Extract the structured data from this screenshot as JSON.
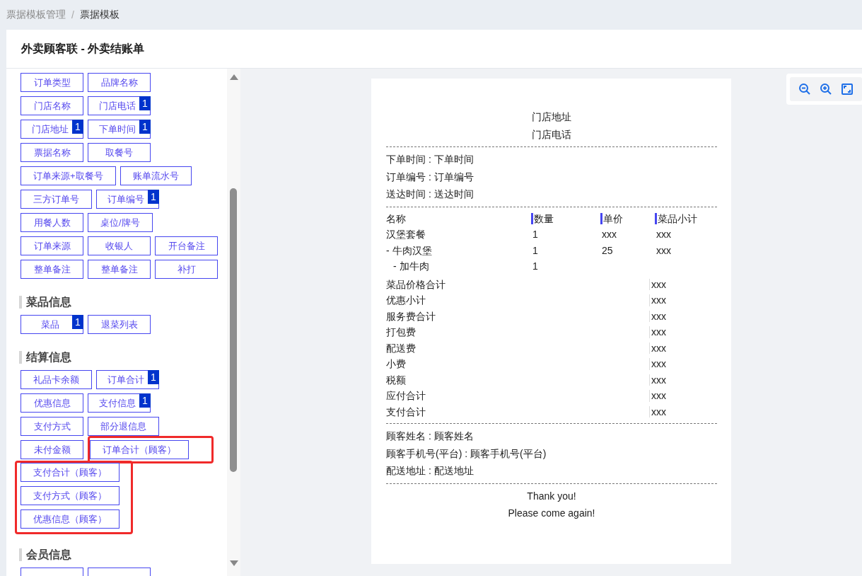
{
  "breadcrumb": {
    "separator": "/",
    "items": [
      {
        "label": "票据模板管理",
        "current": false
      },
      {
        "label": "票据模板",
        "current": true
      }
    ]
  },
  "title": "外卖顾客联 - 外卖结账单",
  "field_sections": [
    {
      "rows": [
        [
          {
            "kind": "chip",
            "label": "订单类型"
          },
          {
            "kind": "chip",
            "label": "品牌名称"
          }
        ],
        [
          {
            "kind": "chip",
            "label": "门店名称"
          },
          {
            "kind": "chip",
            "label": "门店电话",
            "badge": "1"
          }
        ],
        [
          {
            "kind": "chip",
            "label": "门店地址",
            "badge": "1"
          },
          {
            "kind": "chip",
            "label": "下单时间",
            "badge": "1"
          }
        ],
        [
          {
            "kind": "chip",
            "label": "票据名称"
          },
          {
            "kind": "chip",
            "label": "取餐号"
          }
        ],
        [
          {
            "kind": "chip",
            "label": "订单来源+取餐号"
          },
          {
            "kind": "chip",
            "label": "账单流水号"
          }
        ],
        [
          {
            "kind": "chip",
            "label": "三方订单号"
          },
          {
            "kind": "chip",
            "label": "订单编号",
            "badge": "1"
          }
        ],
        [
          {
            "kind": "chip",
            "label": "用餐人数"
          },
          {
            "kind": "chip",
            "label": "桌位/牌号"
          }
        ],
        [
          {
            "kind": "chip",
            "label": "订单来源"
          },
          {
            "kind": "chip",
            "label": "收银人"
          },
          {
            "kind": "chip",
            "label": "开台备注"
          }
        ],
        [
          {
            "kind": "chip",
            "label": "整单备注"
          },
          {
            "kind": "chip",
            "label": "整单备注"
          },
          {
            "kind": "chip",
            "label": "补打"
          }
        ]
      ]
    },
    {
      "heading": "菜品信息",
      "rows": [
        [
          {
            "kind": "chip",
            "label": "菜品",
            "badge": "1"
          },
          {
            "kind": "chip",
            "label": "退菜列表"
          }
        ]
      ]
    },
    {
      "heading": "结算信息",
      "rows": [
        [
          {
            "kind": "chip",
            "label": "礼品卡余额"
          },
          {
            "kind": "chip",
            "label": "订单合计",
            "badge": "1"
          }
        ],
        [
          {
            "kind": "chip",
            "label": "优惠信息"
          },
          {
            "kind": "chip",
            "label": "支付信息",
            "badge": "1"
          }
        ],
        [
          {
            "kind": "chip",
            "label": "支付方式"
          },
          {
            "kind": "chip",
            "label": "部分退信息"
          }
        ],
        [
          {
            "kind": "chip",
            "label": "未付金额"
          },
          {
            "kind": "highlight",
            "items": [
              {
                "kind": "chip",
                "label": "订单合计（顾客）"
              }
            ]
          }
        ],
        [
          {
            "kind": "highlight",
            "items": [
              {
                "kind": "chip",
                "label": "支付合计（顾客）"
              },
              {
                "kind": "chip",
                "label": "支付方式（顾客）"
              },
              {
                "kind": "chip",
                "label": "优惠信息（顾客）"
              }
            ]
          }
        ]
      ]
    },
    {
      "heading": "会员信息",
      "rows": [
        [
          {
            "kind": "chip"
          },
          {
            "kind": "chip"
          }
        ]
      ]
    }
  ],
  "receipt": {
    "header": [
      "门店地址",
      "门店电话"
    ],
    "order_info": [
      "下单时间 : 下单时间",
      "订单编号 : 订单编号",
      "送达时间 : 送达时间"
    ],
    "items_table": {
      "columns": [
        "名称",
        "数量",
        "单价",
        "菜品小计"
      ],
      "rows": [
        {
          "name": "汉堡套餐",
          "quantity": "1",
          "price": "xxx",
          "subtotal": "xxx",
          "children": [
            {
              "name": "- 牛肉汉堡",
              "quantity": "1",
              "price": "25",
              "subtotal": "xxx",
              "children": [
                {
                  "name": "- 加牛肉",
                  "quantity": "1"
                }
              ]
            }
          ]
        }
      ]
    },
    "totals": [
      {
        "label": "菜品价格合计",
        "value": "xxx"
      },
      {
        "label": "优惠小计",
        "value": "xxx"
      },
      {
        "label": "服务费合计",
        "value": "xxx"
      },
      {
        "label": "打包费",
        "value": "xxx"
      },
      {
        "label": "配送费",
        "value": "xxx"
      },
      {
        "label": "小费",
        "value": "xxx"
      },
      {
        "label": "税额",
        "value": "xxx"
      },
      {
        "label": "应付合计",
        "value": "xxx"
      },
      {
        "label": "支付合计",
        "value": "xxx"
      }
    ],
    "customer_info": [
      "顾客姓名 : 顾客姓名",
      "顾客手机号(平台) : 顾客手机号(平台)",
      "配送地址 : 配送地址"
    ],
    "footer": [
      "Thank you!",
      "Please come again!"
    ]
  }
}
